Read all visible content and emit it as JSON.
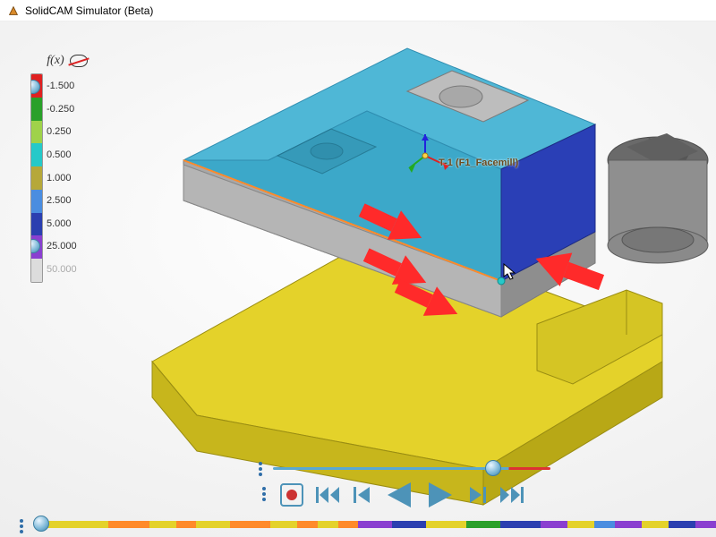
{
  "window": {
    "title": "SolidCAM Simulator (Beta)"
  },
  "scale": {
    "fx_label": "f(x)",
    "items": [
      {
        "color": "#e02020",
        "value": "-1.500"
      },
      {
        "color": "#2aa02a",
        "value": "-0.250"
      },
      {
        "color": "#9fd24a",
        "value": "0.250"
      },
      {
        "color": "#26c9c9",
        "value": "0.500"
      },
      {
        "color": "#b6a83a",
        "value": "1.000"
      },
      {
        "color": "#4a8de0",
        "value": "2.500"
      },
      {
        "color": "#2b3fb0",
        "value": "5.000"
      },
      {
        "color": "#8a3fd0",
        "value": "25.000"
      },
      {
        "color": "#dcdcdc",
        "value": "50.000"
      }
    ],
    "knob_positions_pct": [
      6,
      82
    ]
  },
  "scene": {
    "operation_label": "T-1 (F1_Facemill)",
    "arrow_color": "#ff2a2a",
    "colors": {
      "stock_top": "#4fb7d6",
      "stock_top_shadow": "#2f8db0",
      "stock_strip": "#2a3fb6",
      "stock_front": "#a8a8a8",
      "stock_front_dark": "#8e8e8e",
      "fixture": "#e4d22a",
      "fixture_side": "#c7b61c",
      "tool_body": "#8f8f8f",
      "tool_edge": "#6a6a6a",
      "pocket": "#9d9d9d",
      "edge_highlight": "#ff8a2a",
      "small_dot": "#26c9c9"
    }
  },
  "playback": {
    "speed_slider_pct": 82,
    "buttons": {
      "record": "record",
      "skip_start": "skip-to-start",
      "step_back": "step-back",
      "play_back": "play-reverse",
      "play_fwd": "play-forward",
      "step_fwd": "step-forward",
      "skip_end": "skip-to-end"
    }
  },
  "timeline": {
    "thumb_pct": 0,
    "segments": [
      {
        "color": "#e4d22a",
        "pct": 10
      },
      {
        "color": "#ff8a2a",
        "pct": 6
      },
      {
        "color": "#e4d22a",
        "pct": 4
      },
      {
        "color": "#ff8a2a",
        "pct": 3
      },
      {
        "color": "#e4d22a",
        "pct": 5
      },
      {
        "color": "#ff8a2a",
        "pct": 6
      },
      {
        "color": "#e4d22a",
        "pct": 4
      },
      {
        "color": "#ff8a2a",
        "pct": 3
      },
      {
        "color": "#e4d22a",
        "pct": 3
      },
      {
        "color": "#ff8a2a",
        "pct": 3
      },
      {
        "color": "#8a3fd0",
        "pct": 5
      },
      {
        "color": "#2b3fb0",
        "pct": 5
      },
      {
        "color": "#e4d22a",
        "pct": 6
      },
      {
        "color": "#2aa02a",
        "pct": 5
      },
      {
        "color": "#2b3fb0",
        "pct": 6
      },
      {
        "color": "#8a3fd0",
        "pct": 4
      },
      {
        "color": "#e4d22a",
        "pct": 4
      },
      {
        "color": "#4a8de0",
        "pct": 3
      },
      {
        "color": "#8a3fd0",
        "pct": 4
      },
      {
        "color": "#e4d22a",
        "pct": 4
      },
      {
        "color": "#2b3fb0",
        "pct": 4
      },
      {
        "color": "#8a3fd0",
        "pct": 3
      }
    ]
  }
}
